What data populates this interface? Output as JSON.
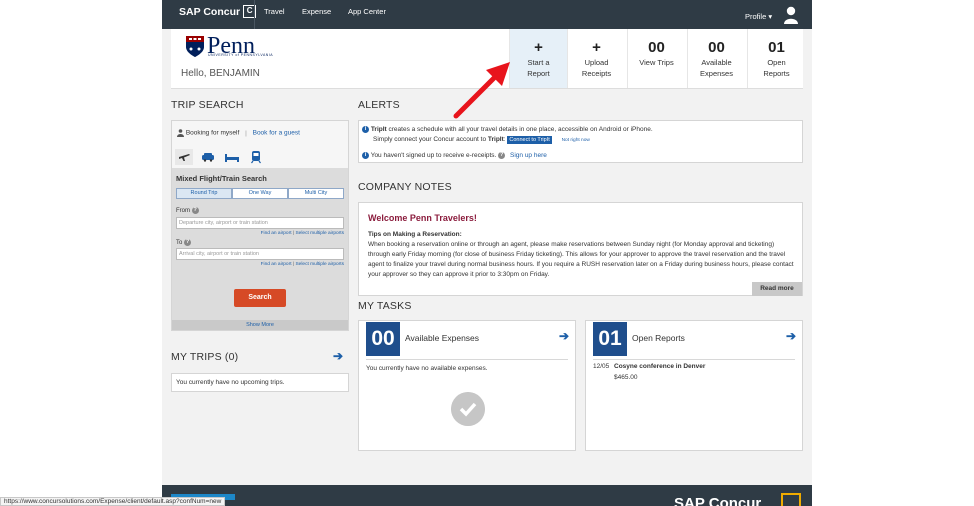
{
  "nav": {
    "brand": "SAP Concur",
    "brand_mark": "C",
    "links": [
      "Travel",
      "Expense",
      "App Center"
    ],
    "profile": "Profile ▾"
  },
  "header": {
    "logo_text": "Penn",
    "logo_sub": "UNIVERSITY of PENNSYLVANIA",
    "greeting": "Hello, BENJAMIN",
    "tiles": [
      {
        "big": "+",
        "label1": "Start a",
        "label2": "Report"
      },
      {
        "big": "+",
        "label1": "Upload",
        "label2": "Receipts"
      },
      {
        "big": "00",
        "label1": "View Trips",
        "label2": ""
      },
      {
        "big": "00",
        "label1": "Available",
        "label2": "Expenses"
      },
      {
        "big": "01",
        "label1": "Open",
        "label2": "Reports"
      }
    ]
  },
  "trip_search": {
    "title": "TRIP SEARCH",
    "booking_for": "Booking for myself",
    "separator": "|",
    "guest_link": "Book for a guest",
    "form_title": "Mixed Flight/Train Search",
    "segments": [
      "Round Trip",
      "One Way",
      "Multi City"
    ],
    "from_label": "From",
    "from_placeholder": "Departure city, airport or train station",
    "to_label": "To",
    "to_placeholder": "Arrival city, airport or train station",
    "find_airport": "Find an airport",
    "select_multiple": "Select multiple airports",
    "search_button": "Search",
    "show_more": "Show More"
  },
  "my_trips": {
    "title": "MY TRIPS (0)",
    "arrow": "➔",
    "empty": "You currently have no upcoming trips."
  },
  "alerts": {
    "title": "ALERTS",
    "tripit_bold": "TripIt",
    "tripit_text": " creates a schedule with all your travel details in one place, accessible on Android or iPhone.",
    "tripit_line2": "Simply connect your Concur account to ",
    "tripit_bold2": "TripIt",
    "connect_button": "Connect to TripIt",
    "not_now": "Not right now",
    "ereceipts_text": "You haven't signed up to receive e-receipts.",
    "signup_link": "Sign up here"
  },
  "company_notes": {
    "title": "COMPANY NOTES",
    "heading": "Welcome Penn Travelers!",
    "subheading": "Tips on Making a Reservation:",
    "body": "When booking a reservation online or through an agent, please make reservations between Sunday night (for Monday approval and ticketing) through early Friday morning (for close of business Friday ticketing).  This allows for your approver to approve the travel reservation and the travel agent to finalize your travel during normal business hours.  If you require a RUSH reservation later on a Friday during business hours, please contact your approver so they can approve it prior to 3:30pm on Friday.",
    "read_more": "Read more"
  },
  "my_tasks": {
    "title": "MY TASKS",
    "expenses": {
      "num": "00",
      "label": "Available Expenses",
      "empty": "You currently have no available expenses."
    },
    "reports": {
      "num": "01",
      "label": "Open Reports",
      "date": "12/05",
      "name": "Cosyne conference in Denver",
      "amount": "$465.00"
    }
  },
  "footer": {
    "brand": "SAP Concur"
  },
  "status_url": "https://www.concursolutions.com/Expense/client/default.asp?confNum=new",
  "colors": {
    "nav": "#2f3b45",
    "accent_blue": "#1d5fa8",
    "search_orange": "#d64a26",
    "penn_red": "#8b1c3d",
    "task_blue": "#1f4e8c"
  }
}
